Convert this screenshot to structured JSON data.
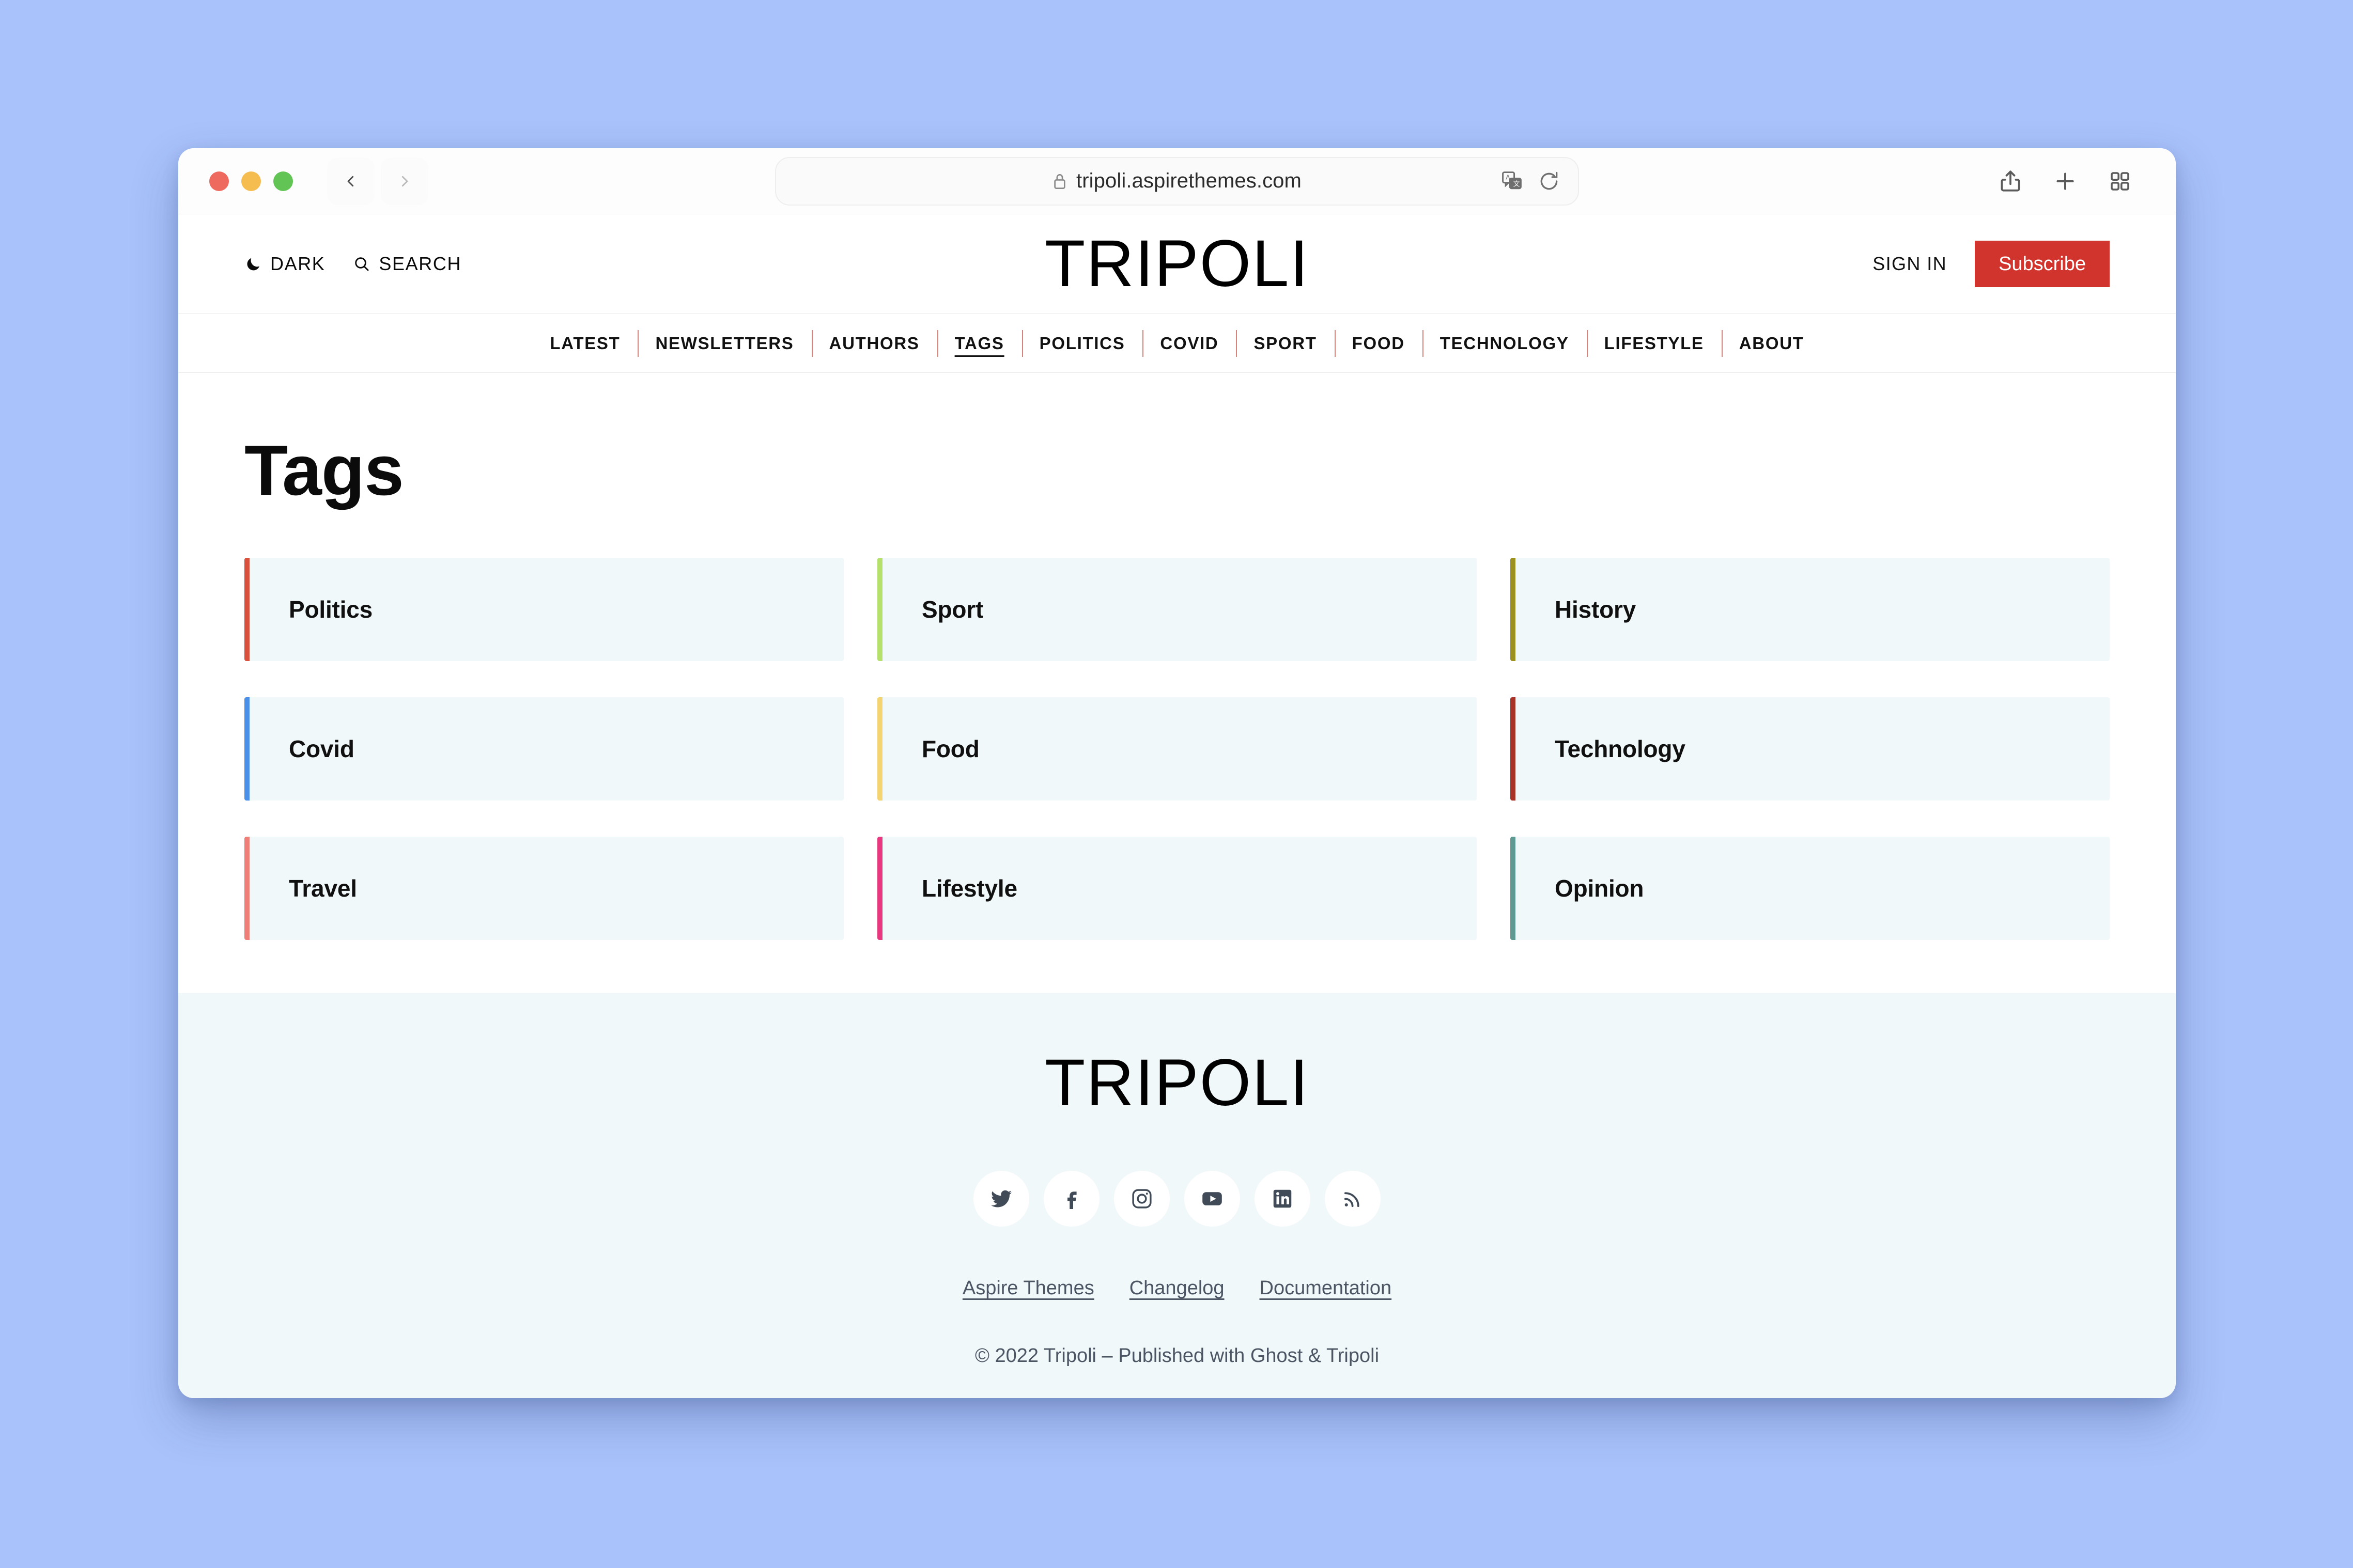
{
  "browser": {
    "url": "tripoli.aspirethemes.com",
    "lock_icon": "lock-icon",
    "translate_icon": "translate-icon",
    "reload_icon": "reload-icon",
    "back_icon": "chevron-left-icon",
    "forward_icon": "chevron-right-icon",
    "share_icon": "share-icon",
    "new_tab_icon": "plus-icon",
    "tab_overview_icon": "tab-overview-icon",
    "traffic_lights": [
      "close-red",
      "minimize-yellow",
      "zoom-green"
    ]
  },
  "header": {
    "dark_label": "DARK",
    "dark_icon": "moon-icon",
    "search_label": "SEARCH",
    "search_icon": "search-icon",
    "logo": "TRIPOLI",
    "sign_in_label": "SIGN IN",
    "subscribe_label": "Subscribe",
    "subscribe_color": "#d0342c"
  },
  "nav": {
    "items": [
      {
        "label": "LATEST",
        "active": false
      },
      {
        "label": "NEWSLETTERS",
        "active": false
      },
      {
        "label": "AUTHORS",
        "active": false
      },
      {
        "label": "TAGS",
        "active": true
      },
      {
        "label": "POLITICS",
        "active": false
      },
      {
        "label": "COVID",
        "active": false
      },
      {
        "label": "SPORT",
        "active": false
      },
      {
        "label": "FOOD",
        "active": false
      },
      {
        "label": "TECHNOLOGY",
        "active": false
      },
      {
        "label": "LIFESTYLE",
        "active": false
      },
      {
        "label": "ABOUT",
        "active": false
      }
    ]
  },
  "main": {
    "title": "Tags",
    "card_background": "#f1f8f9",
    "tags": [
      {
        "name": "Politics",
        "accent": "#d9503c"
      },
      {
        "name": "Sport",
        "accent": "#b5e06b"
      },
      {
        "name": "History",
        "accent": "#9c9021"
      },
      {
        "name": "Covid",
        "accent": "#4a90e8"
      },
      {
        "name": "Food",
        "accent": "#f4d472"
      },
      {
        "name": "Technology",
        "accent": "#a93226"
      },
      {
        "name": "Travel",
        "accent": "#ef7d78"
      },
      {
        "name": "Lifestyle",
        "accent": "#e8387f"
      },
      {
        "name": "Opinion",
        "accent": "#5e9a92"
      }
    ]
  },
  "footer": {
    "logo": "TRIPOLI",
    "socials": [
      {
        "name": "twitter-icon"
      },
      {
        "name": "facebook-icon"
      },
      {
        "name": "instagram-icon"
      },
      {
        "name": "youtube-icon"
      },
      {
        "name": "linkedin-icon"
      },
      {
        "name": "rss-icon"
      }
    ],
    "links": [
      {
        "label": "Aspire Themes"
      },
      {
        "label": "Changelog"
      },
      {
        "label": "Documentation"
      }
    ],
    "copyright": "© 2022 Tripoli – Published with Ghost & Tripoli"
  }
}
